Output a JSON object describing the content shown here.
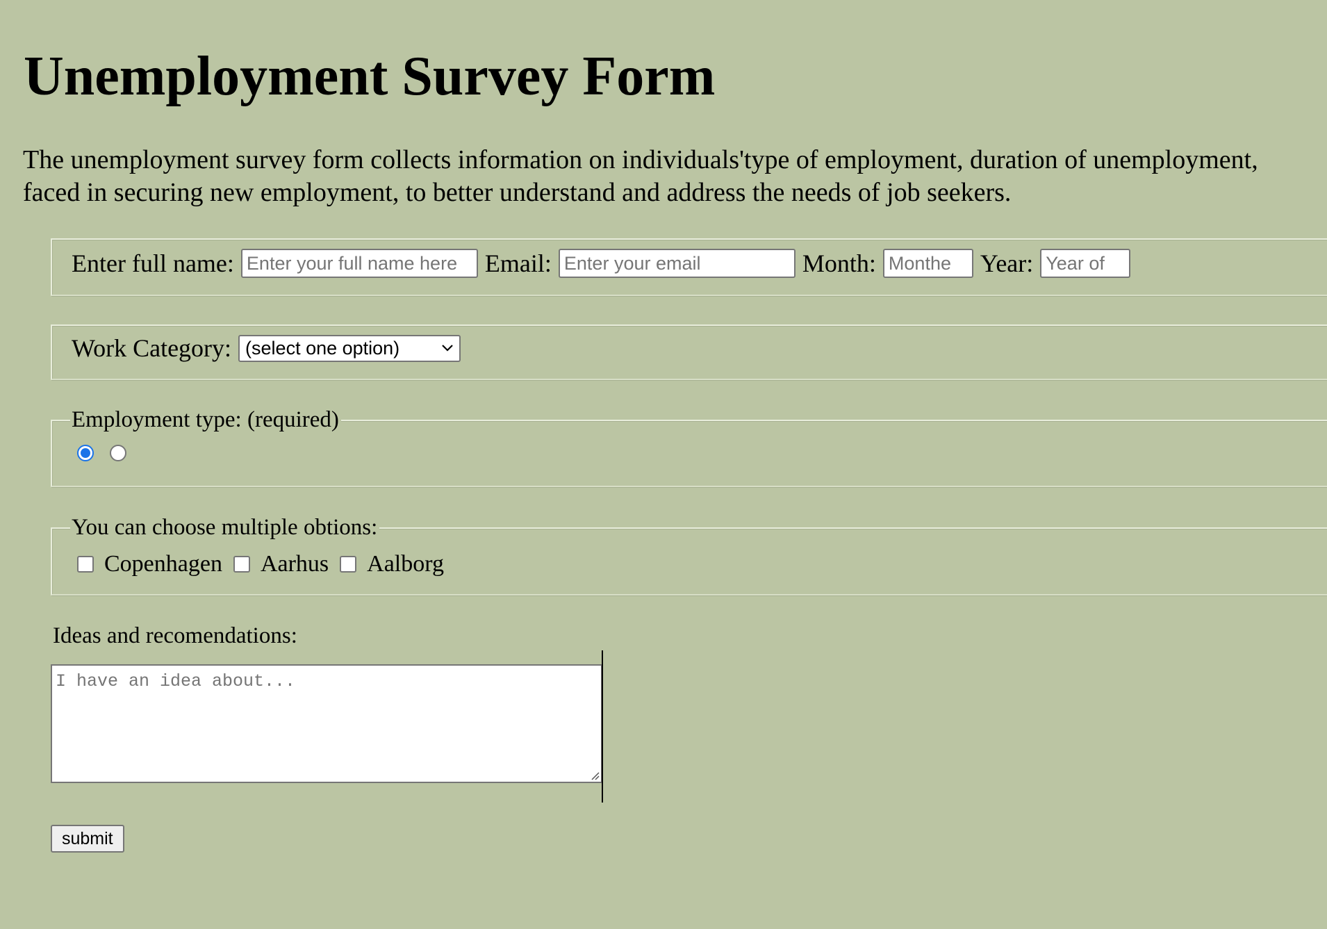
{
  "page": {
    "title": "Unemployment Survey Form",
    "description_line1": "The unemployment survey form collects information on individuals'type of employment, duration of unemployment,",
    "description_line2": "faced in securing new employment, to better understand and address the needs of job seekers."
  },
  "personal": {
    "name_label": "Enter full name:",
    "name_placeholder": "Enter your full name here",
    "email_label": "Email:",
    "email_placeholder": "Enter your email",
    "month_label": "Month:",
    "month_placeholder": "Monthe",
    "year_label": "Year:",
    "year_placeholder": "Year of"
  },
  "work": {
    "label": "Work Category:",
    "selected": "(select one option)"
  },
  "employment_type": {
    "legend": "Employment type: (required)",
    "options": [
      {
        "checked": true
      },
      {
        "checked": false
      }
    ]
  },
  "cities": {
    "legend": "You can choose multiple obtions:",
    "options": [
      {
        "label": "Copenhagen",
        "checked": false
      },
      {
        "label": "Aarhus",
        "checked": false
      },
      {
        "label": "Aalborg",
        "checked": false
      }
    ]
  },
  "ideas": {
    "label": "Ideas and recomendations:",
    "placeholder": "I have an idea about..."
  },
  "submit_label": "submit",
  "colors": {
    "background": "#bbc5a3",
    "radio_accent": "#1a73e8"
  }
}
